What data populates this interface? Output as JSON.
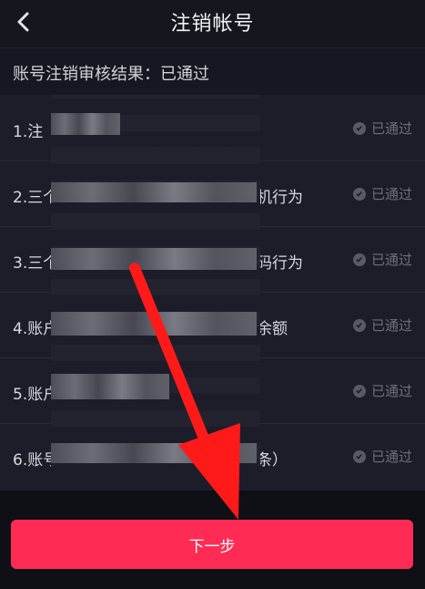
{
  "header": {
    "title": "注销帐号",
    "back_icon": "chevron-left-icon"
  },
  "result": {
    "text": "账号注销审核结果：已通过"
  },
  "conditions": [
    {
      "label": "1.注",
      "suffix": "",
      "status": "已通过"
    },
    {
      "label": "2.三个",
      "suffix": "机行为",
      "status": "已通过"
    },
    {
      "label": "3.三个",
      "suffix": "码行为",
      "status": "已通过"
    },
    {
      "label": "4.账户",
      "suffix": "余额",
      "status": "已通过"
    },
    {
      "label": "5.账户",
      "suffix": "",
      "status": "已通过"
    },
    {
      "label": "6.账号",
      "suffix": "条）",
      "status": "已通过"
    }
  ],
  "footer": {
    "next_label": "下一步",
    "accent_color": "#fe2c55",
    "annotation_color": "#ff1a1a"
  }
}
